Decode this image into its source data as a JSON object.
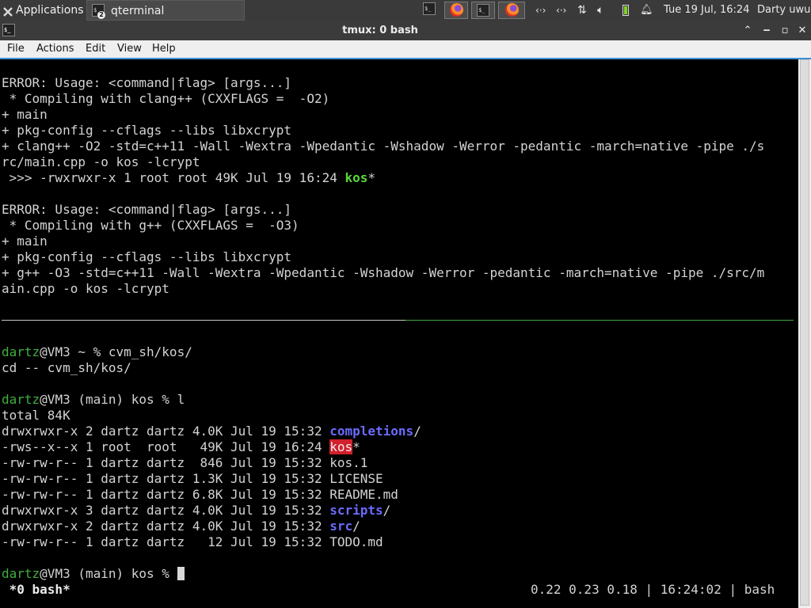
{
  "panel": {
    "applications_label": "Applications",
    "task_label": "qterminal",
    "task_badge": "2",
    "clock": "Tue 19 Jul, 16:24",
    "user": "Darty uwu"
  },
  "window": {
    "title": "tmux: 0 bash"
  },
  "menu": [
    "File",
    "Actions",
    "Edit",
    "View",
    "Help"
  ],
  "terminal": {
    "top_pane": {
      "lines": [
        "ERROR: Usage: <command|flag> [args...]",
        " * Compiling with clang++ (CXXFLAGS =  -O2)",
        "+ main",
        "+ pkg-config --cflags --libs libxcrypt",
        "+ clang++ -O2 -std=c++11 -Wall -Wextra -Wpedantic -Wshadow -Werror -pedantic -march=native -pipe ./s",
        "rc/main.cpp -o kos -lcrypt"
      ],
      "result1_prefix": " >>> -rwxrwxr-x 1 root root 49K Jul 19 16:24 ",
      "result1_name": "kos",
      "result1_suffix": "*",
      "lines2": [
        "ERROR: Usage: <command|flag> [args...]",
        " * Compiling with g++ (CXXFLAGS =  -O3)",
        "+ main",
        "+ pkg-config --cflags --libs libxcrypt",
        "+ g++ -O3 -std=c++11 -Wall -Wextra -Wpedantic -Wshadow -Werror -pedantic -march=native -pipe ./src/m",
        "ain.cpp -o kos -lcrypt"
      ]
    },
    "bottom_pane": {
      "prompt1_user": "dartz",
      "prompt1_rest": "@VM3 ~ % cvm_sh/kos/",
      "cd_line": "cd -- cvm_sh/kos/",
      "prompt2_user": "dartz",
      "prompt2_rest": "@VM3 (main) kos % l",
      "total": "total 84K",
      "listing": [
        {
          "meta": "drwxrwxr-x 2 dartz dartz 4.0K Jul 19 15:32 ",
          "name": "completions",
          "suffix": "/",
          "style": "blue"
        },
        {
          "meta": "-rws--x--x 1 root  root   49K Jul 19 16:24 ",
          "name": "kos",
          "suffix": "*",
          "style": "hl"
        },
        {
          "meta": "-rw-rw-r-- 1 dartz dartz  846 Jul 19 15:32 ",
          "name": "kos.1",
          "suffix": "",
          "style": ""
        },
        {
          "meta": "-rw-rw-r-- 1 dartz dartz 1.3K Jul 19 15:32 ",
          "name": "LICENSE",
          "suffix": "",
          "style": ""
        },
        {
          "meta": "-rw-rw-r-- 1 dartz dartz 6.8K Jul 19 15:32 ",
          "name": "README.md",
          "suffix": "",
          "style": ""
        },
        {
          "meta": "drwxrwxr-x 3 dartz dartz 4.0K Jul 19 15:32 ",
          "name": "scripts",
          "suffix": "/",
          "style": "blue"
        },
        {
          "meta": "drwxrwxr-x 2 dartz dartz 4.0K Jul 19 15:32 ",
          "name": "src",
          "suffix": "/",
          "style": "blue"
        },
        {
          "meta": "-rw-rw-r-- 1 dartz dartz   12 Jul 19 15:32 ",
          "name": "TODO.md",
          "suffix": "",
          "style": ""
        }
      ],
      "prompt3_user": "dartz",
      "prompt3_rest": "@VM3 (main) kos % "
    },
    "status": {
      "left": " *0 bash*",
      "right": "0.22 0.23 0.18 | 16:24:02 | bash"
    }
  },
  "colors": {
    "panel_bg": "#3a3a3a",
    "pane_divider": "#3ea83e",
    "highlight": "#d0202c",
    "dir_blue": "#6b6bff",
    "exec_green": "#59d83a"
  }
}
